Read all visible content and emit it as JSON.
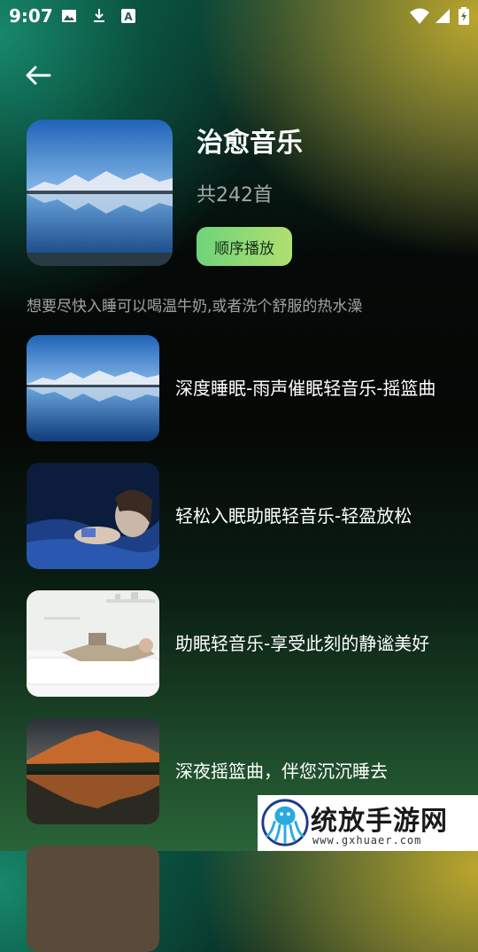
{
  "status_bar": {
    "time": "9:07",
    "icons": [
      "image-icon",
      "download-icon",
      "text-a-icon",
      "wifi-icon",
      "signal-icon",
      "battery-icon"
    ]
  },
  "nav": {
    "back_icon": "back-arrow-icon"
  },
  "playlist": {
    "title": "治愈音乐",
    "count": "共242首",
    "play_button": "顺序播放",
    "description": "想要尽快入睡可以喝温牛奶,或者洗个舒服的热水澡",
    "button_gradient": [
      "#6fd37a",
      "#b0e070"
    ]
  },
  "songs": [
    {
      "title": "深度睡眠-雨声催眠轻音乐-摇篮曲",
      "cover": "mountain-lake-reflection"
    },
    {
      "title": "轻松入眠助眠轻音乐-轻盈放松",
      "cover": "person-lying-with-phone"
    },
    {
      "title": "助眠轻音乐-享受此刻的静谧美好",
      "cover": "man-resting-on-sofa"
    },
    {
      "title": "深夜摇篮曲，伴您沉沉睡去",
      "cover": "sunset-mountain-lake"
    }
  ],
  "watermark": {
    "title": "统放手游网",
    "url": "www.gxhuaer.com"
  }
}
